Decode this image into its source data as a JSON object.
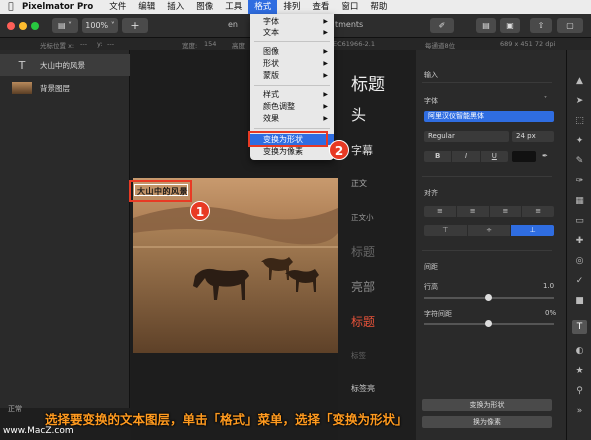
{
  "menubar": {
    "app_name": "Pixelmator Pro",
    "items": [
      "文件",
      "编辑",
      "插入",
      "图像",
      "工具",
      "格式",
      "排列",
      "查看",
      "窗口",
      "帮助"
    ],
    "active_item": "格式"
  },
  "toolbar": {
    "zoom_value": "100%",
    "add_label": "+",
    "doc_title_left": "en",
    "doc_title_right": "tments"
  },
  "infobar": {
    "cursor_label": "光标位置 x:",
    "cursor_x": "---",
    "cursor_y_label": "y:",
    "cursor_y": "---",
    "width_label": "宽度:",
    "width_value": "154",
    "height_label": "高度",
    "profile": "EC61966-2.1",
    "channel": "每通道8位",
    "dimensions": "689 x 451 72 dpi"
  },
  "layers": {
    "items": [
      {
        "name": "大山中的风景",
        "type": "text",
        "selected": true
      },
      {
        "name": "背景图层",
        "type": "image",
        "selected": false
      }
    ],
    "blend_mode": "正常"
  },
  "canvas": {
    "text_layer_content": "大山中的风景"
  },
  "format_menu": {
    "items": [
      {
        "label": "字体",
        "submenu": true
      },
      {
        "label": "文本",
        "submenu": true
      },
      {
        "label": "图像",
        "submenu": true
      },
      {
        "label": "形状",
        "submenu": true
      },
      {
        "label": "蒙版",
        "submenu": true
      },
      {
        "label": "样式",
        "submenu": true
      },
      {
        "label": "颜色调整",
        "submenu": true
      },
      {
        "label": "效果",
        "submenu": true
      },
      {
        "label": "变换为形状",
        "submenu": false,
        "highlighted": true
      },
      {
        "label": "变换为像素",
        "submenu": false
      }
    ]
  },
  "styles_panel": {
    "items": [
      "标题",
      "头",
      "字幕",
      "正文",
      "正文小",
      "标题",
      "亮部",
      "标题",
      "标签",
      "标签亮"
    ]
  },
  "inspector": {
    "input_label": "输入",
    "font_section": "字体",
    "font_family": "阿里汉仪智能黑体",
    "font_style": "Regular",
    "font_size": "24 px",
    "style_buttons": [
      "B",
      "I",
      "U"
    ],
    "align_section": "对齐",
    "spacing_section": "间距",
    "line_height_label": "行高",
    "line_height_value": "1.0",
    "char_spacing_label": "字符间距",
    "char_spacing_value": "0%",
    "convert_shape_button": "变换为形状",
    "convert_pixel_button": "换为像素"
  },
  "annotations": {
    "badge_1": "1",
    "badge_2": "2",
    "caption": "选择要变换的文本图层，单击「格式」菜单，选择「变换为形状」",
    "watermark": "www.MacZ.com"
  },
  "colors": {
    "accent": "#2f6de1",
    "annotation_red": "#e83a24",
    "caption_orange": "#ff9a1f"
  }
}
